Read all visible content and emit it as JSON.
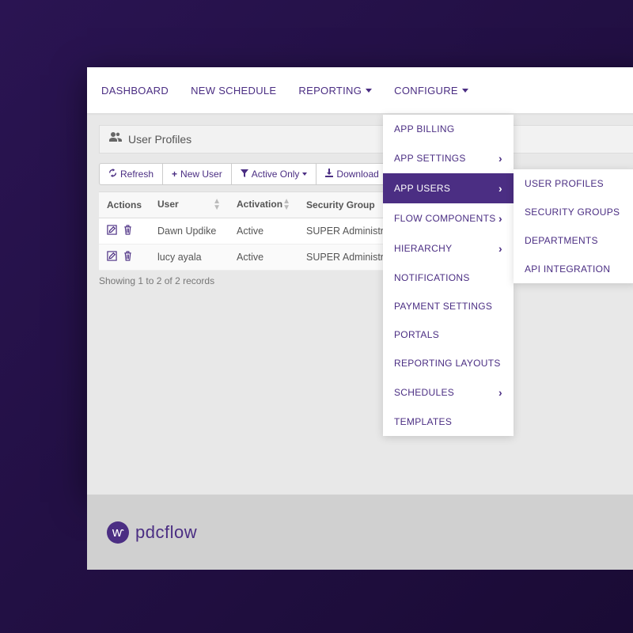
{
  "nav": {
    "items": [
      {
        "label": "DASHBOARD",
        "has_caret": false
      },
      {
        "label": "NEW SCHEDULE",
        "has_caret": false
      },
      {
        "label": "REPORTING",
        "has_caret": true
      },
      {
        "label": "CONFIGURE",
        "has_caret": true
      }
    ]
  },
  "page_header": {
    "title": "User Profiles"
  },
  "toolbar": {
    "refresh": "Refresh",
    "new_user": "New User",
    "filter": "Active Only",
    "download": "Download"
  },
  "table": {
    "headers": [
      "Actions",
      "User",
      "Activation",
      "Security Group"
    ],
    "rows": [
      {
        "user": "Dawn Updike",
        "activation": "Active",
        "group": "SUPER Administrator"
      },
      {
        "user": "lucy ayala",
        "activation": "Active",
        "group": "SUPER Administrator"
      }
    ],
    "footer": "Showing 1 to 2 of 2 records"
  },
  "configure_menu": {
    "items": [
      {
        "label": "APP BILLING",
        "has_sub": false
      },
      {
        "label": "APP SETTINGS",
        "has_sub": true
      },
      {
        "label": "APP USERS",
        "has_sub": true,
        "active": true
      },
      {
        "label": "FLOW COMPONENTS",
        "has_sub": true
      },
      {
        "label": "HIERARCHY",
        "has_sub": true
      },
      {
        "label": "NOTIFICATIONS",
        "has_sub": false
      },
      {
        "label": "PAYMENT SETTINGS",
        "has_sub": false
      },
      {
        "label": "PORTALS",
        "has_sub": false
      },
      {
        "label": "REPORTING LAYOUTS",
        "has_sub": false
      },
      {
        "label": "SCHEDULES",
        "has_sub": true
      },
      {
        "label": "TEMPLATES",
        "has_sub": false
      }
    ]
  },
  "app_users_submenu": {
    "items": [
      {
        "label": "USER PROFILES"
      },
      {
        "label": "SECURITY GROUPS"
      },
      {
        "label": "DEPARTMENTS"
      },
      {
        "label": "API INTEGRATION"
      }
    ]
  },
  "brand": {
    "name": "pdcflow"
  }
}
